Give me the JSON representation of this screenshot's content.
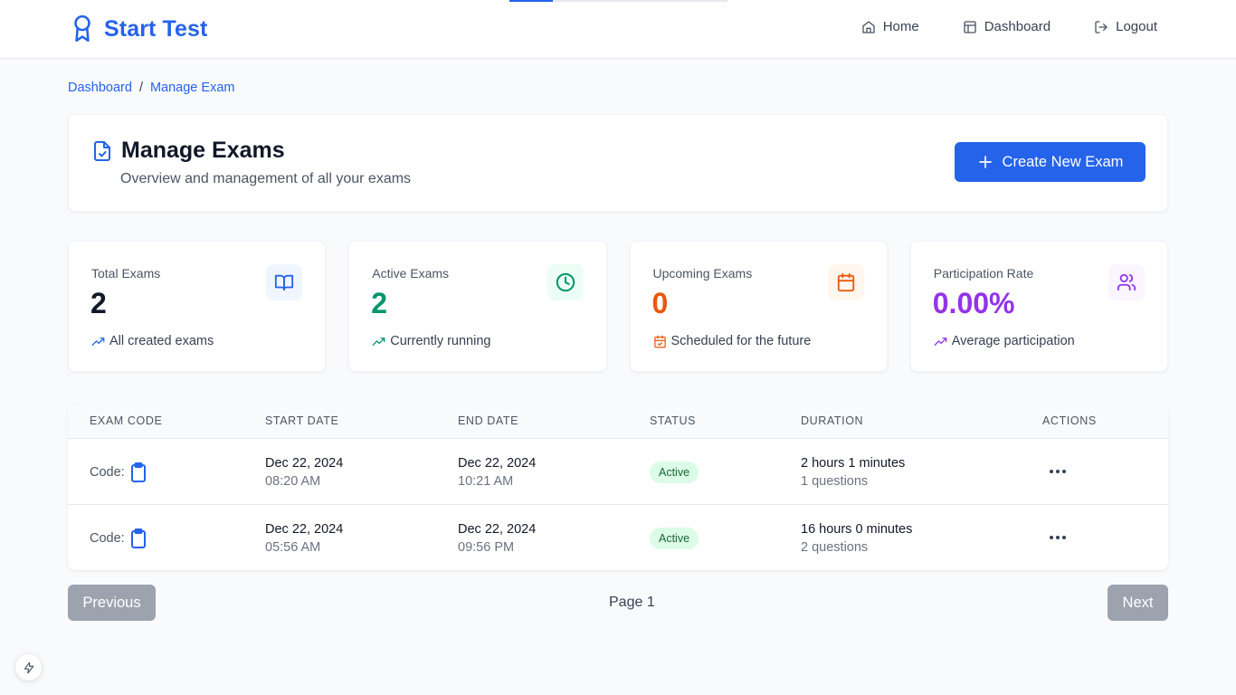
{
  "loading_bar": {
    "progress": 0.2
  },
  "brand": {
    "title": "Start Test",
    "icon": "award-ribbon-icon"
  },
  "nav": {
    "items": [
      {
        "label": "Home",
        "icon": "home-icon"
      },
      {
        "label": "Dashboard",
        "icon": "layout-icon"
      },
      {
        "label": "Logout",
        "icon": "logout-icon"
      }
    ]
  },
  "breadcrumb": {
    "items": [
      "Dashboard",
      "Manage Exam"
    ],
    "separator": "/"
  },
  "header": {
    "title": "Manage Exams",
    "subtitle": "Overview and management of all your exams",
    "icon": "file-check-icon",
    "create_button": "Create New Exam"
  },
  "stats": [
    {
      "label": "Total Exams",
      "value": "2",
      "footer": "All created exams",
      "icon": "book-open-icon",
      "foot_icon": "trending-up-icon",
      "color": "#111827",
      "accent": "#2563eb",
      "bg": "#eff6ff"
    },
    {
      "label": "Active Exams",
      "value": "2",
      "footer": "Currently running",
      "icon": "clock-icon",
      "foot_icon": "trending-up-icon",
      "color": "#059669",
      "accent": "#059669",
      "bg": "#ecfdf5"
    },
    {
      "label": "Upcoming Exams",
      "value": "0",
      "footer": "Scheduled for the future",
      "icon": "calendar-icon",
      "foot_icon": "calendar-check-icon",
      "color": "#ea580c",
      "accent": "#ea580c",
      "bg": "#fff7ed"
    },
    {
      "label": "Participation Rate",
      "value": "0.00%",
      "footer": "Average participation",
      "icon": "users-icon",
      "foot_icon": "trending-up-icon",
      "color": "#9333ea",
      "accent": "#9333ea",
      "bg": "#faf5ff"
    }
  ],
  "table": {
    "columns": [
      "EXAM CODE",
      "START DATE",
      "END DATE",
      "STATUS",
      "DURATION",
      "ACTIONS"
    ],
    "rows": [
      {
        "code_label": "Code:",
        "start_date": "Dec 22, 2024",
        "start_time": "08:20 AM",
        "end_date": "Dec 22, 2024",
        "end_time": "10:21 AM",
        "status": "Active",
        "duration": "2 hours 1 minutes",
        "questions": "1 questions"
      },
      {
        "code_label": "Code:",
        "start_date": "Dec 22, 2024",
        "start_time": "05:56 AM",
        "end_date": "Dec 22, 2024",
        "end_time": "09:56 PM",
        "status": "Active",
        "duration": "16 hours 0 minutes",
        "questions": "2 questions"
      }
    ]
  },
  "pagination": {
    "previous": "Previous",
    "page_label": "Page 1",
    "next": "Next"
  },
  "colors": {
    "primary": "#2563eb",
    "disabled": "#9ca3af",
    "status_active_bg": "#dcfce7",
    "status_active_text": "#166534"
  }
}
